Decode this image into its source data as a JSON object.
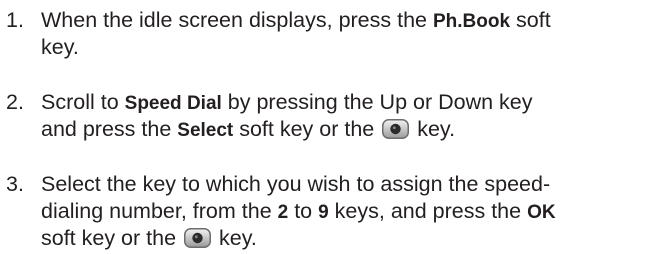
{
  "steps": [
    {
      "number": "1.",
      "line1_a": "When the idle screen displays, press the ",
      "line1_bold": "Ph.Book",
      "line1_b": " soft",
      "line2": "key."
    },
    {
      "number": "2.",
      "line1_a": "Scroll to ",
      "line1_bold": "Speed Dial",
      "line1_b": " by pressing the Up or Down key",
      "line2_a": "and press the ",
      "line2_bold": "Select",
      "line2_b": " soft key or the ",
      "line2_c": " key.",
      "icon": "center-select-key-icon"
    },
    {
      "number": "3.",
      "line1": "Select the key to which you wish to assign the speed-",
      "line2_a": "dialing number, from the ",
      "line2_bold1": "2",
      "line2_b": " to ",
      "line2_bold2": "9",
      "line2_c": " keys, and press the ",
      "line2_bold3": "OK",
      "line3_a": "soft key or the ",
      "line3_b": " key.",
      "icon": "center-select-key-icon"
    }
  ]
}
